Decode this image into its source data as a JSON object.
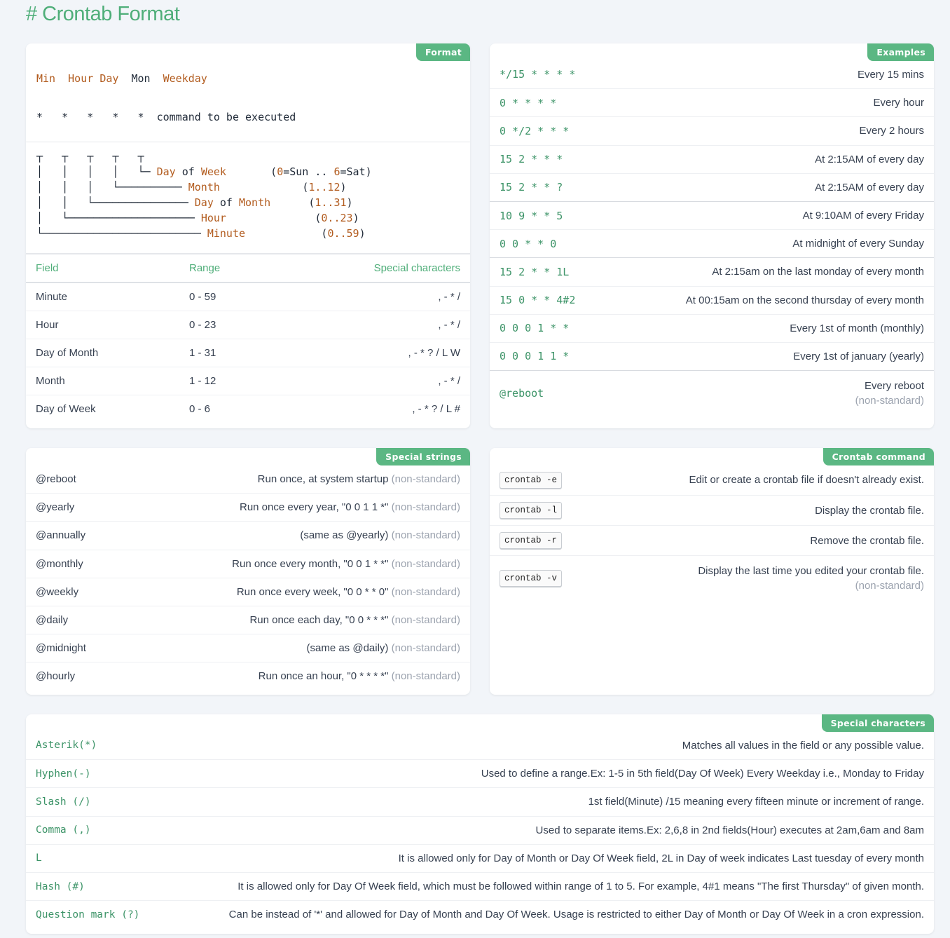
{
  "page": {
    "title": "# Crontab Format"
  },
  "format": {
    "badge": "Format",
    "header": {
      "min": "Min",
      "hour": "Hour",
      "day": "Day",
      "mon": "Mon",
      "weekday": "Weekday"
    },
    "stars_line": "*   *   *   *   *",
    "command": "command to be executed",
    "tree": [
      {
        "prefix": "┬   ┬   ┬   ┬   ┬",
        "label": [],
        "range": ""
      },
      {
        "prefix": "│   │   │   │   └─ ",
        "label": [
          "Day",
          " of ",
          "Week"
        ],
        "range_parts": [
          "(",
          "0",
          "=Sun .. ",
          "6",
          "=Sat)"
        ]
      },
      {
        "prefix": "│   │   │   └────────── ",
        "label": [
          "Month"
        ],
        "range_parts": [
          "(",
          "1..12",
          ")"
        ]
      },
      {
        "prefix": "│   │   └─────────────── ",
        "label": [
          "Day",
          " of ",
          "Month"
        ],
        "range_parts": [
          "(",
          "1..31",
          ")"
        ]
      },
      {
        "prefix": "│   └──────────────────── ",
        "label": [
          "Hour"
        ],
        "range_parts": [
          "(",
          "0..23",
          ")"
        ]
      },
      {
        "prefix": "└───────────────────────── ",
        "label": [
          "Minute"
        ],
        "range_parts": [
          "(",
          "0..59",
          ")"
        ]
      }
    ],
    "table": {
      "headers": [
        "Field",
        "Range",
        "Special characters"
      ],
      "rows": [
        [
          "Minute",
          "0 - 59",
          ", - * /"
        ],
        [
          "Hour",
          "0 - 23",
          ", - * /"
        ],
        [
          "Day of Month",
          "1 - 31",
          ", - * ? / L W"
        ],
        [
          "Month",
          "1 - 12",
          ", - * /"
        ],
        [
          "Day of Week",
          "0 - 6",
          ", - * ? / L #"
        ]
      ]
    }
  },
  "examples": {
    "badge": "Examples",
    "items": [
      {
        "expr": "*/15 * * * *",
        "desc": "Every 15 mins"
      },
      {
        "expr": "0 * * * *",
        "desc": "Every hour"
      },
      {
        "expr": "0 */2 * * *",
        "desc": "Every 2 hours"
      },
      {
        "expr": "15 2 * * *",
        "desc": "At 2:15AM of every day"
      },
      {
        "expr": "15 2 * * ?",
        "desc": "At 2:15AM of every day"
      },
      {
        "expr": "10 9 * * 5",
        "desc": "At 9:10AM of every Friday"
      },
      {
        "expr": "0 0 * * 0",
        "desc": "At midnight of every Sunday"
      },
      {
        "expr": "15 2 * * 1L",
        "desc": "At 2:15am on the last monday of every month"
      },
      {
        "expr": "15 0 * * 4#2",
        "desc": "At 00:15am on the second thursday of every month"
      },
      {
        "expr": "0 0 0 1 * *",
        "desc": "Every 1st of month (monthly)"
      },
      {
        "expr": "0 0 0 1 1 *",
        "desc": "Every 1st of january (yearly)"
      },
      {
        "expr": "@reboot",
        "desc": "Every reboot",
        "note": "(non-standard)"
      }
    ]
  },
  "special_strings": {
    "badge": "Special strings",
    "items": [
      {
        "name": "@reboot",
        "desc": "Run once, at system startup",
        "note": "(non-standard)"
      },
      {
        "name": "@yearly",
        "desc": "Run once every year, \"0 0 1 1 *\"",
        "note": "(non-standard)"
      },
      {
        "name": "@annually",
        "desc": "(same as @yearly)",
        "note": "(non-standard)"
      },
      {
        "name": "@monthly",
        "desc": "Run once every month, \"0 0 1 * *\"",
        "note": "(non-standard)"
      },
      {
        "name": "@weekly",
        "desc": "Run once every week, \"0 0 * * 0\"",
        "note": "(non-standard)"
      },
      {
        "name": "@daily",
        "desc": "Run once each day, \"0 0 * * *\"",
        "note": "(non-standard)"
      },
      {
        "name": "@midnight",
        "desc": "(same as @daily)",
        "note": "(non-standard)"
      },
      {
        "name": "@hourly",
        "desc": "Run once an hour, \"0 * * * *\"",
        "note": "(non-standard)"
      }
    ]
  },
  "crontab_command": {
    "badge": "Crontab command",
    "items": [
      {
        "cmd": "crontab -e",
        "desc": "Edit or create a crontab file if doesn't already exist."
      },
      {
        "cmd": "crontab -l",
        "desc": "Display the crontab file."
      },
      {
        "cmd": "crontab -r",
        "desc": "Remove the crontab file."
      },
      {
        "cmd": "crontab -v",
        "desc": "Display the last time you edited your crontab file.",
        "note": "(non-standard)"
      }
    ]
  },
  "special_characters": {
    "badge": "Special characters",
    "items": [
      {
        "name": "Asterik(*)",
        "desc": "Matches all values in the field or any possible value."
      },
      {
        "name": "Hyphen(-)",
        "desc": "Used to define a range.Ex: 1-5 in 5th field(Day Of Week) Every Weekday i.e., Monday to Friday"
      },
      {
        "name": "Slash (/)",
        "desc": "1st field(Minute) /15 meaning every fifteen minute or increment of range."
      },
      {
        "name": "Comma (,)",
        "desc": "Used to separate items.Ex: 2,6,8 in 2nd fields(Hour) executes at 2am,6am and 8am"
      },
      {
        "name": "L",
        "desc": "It is allowed only for Day of Month or Day Of Week field, 2L in Day of week indicates Last tuesday of every month"
      },
      {
        "name": "Hash (#)",
        "desc": "It is allowed only for Day Of Week field, which must be followed within range of 1 to 5. For example, 4#1 means \"The first Thursday\" of given month."
      },
      {
        "name": "Question mark (?)",
        "desc": "Can be instead of '*' and allowed for Day of Month and Day Of Week. Usage is restricted to either Day of Month or Day Of Week in a cron expression."
      }
    ]
  }
}
